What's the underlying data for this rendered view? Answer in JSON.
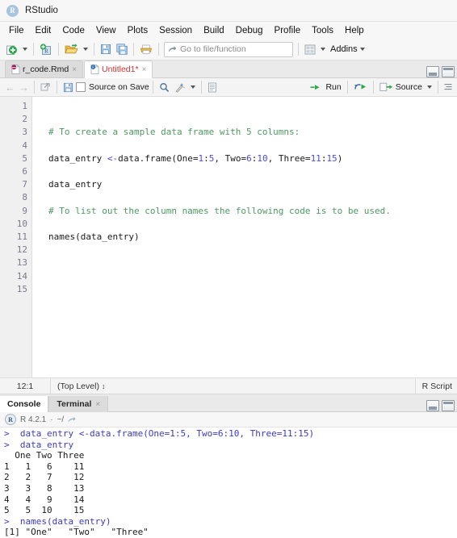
{
  "window": {
    "app_title": "RStudio",
    "logo_letter": "R"
  },
  "menubar": {
    "items": [
      {
        "label": "File"
      },
      {
        "label": "Edit"
      },
      {
        "label": "Code"
      },
      {
        "label": "View"
      },
      {
        "label": "Plots"
      },
      {
        "label": "Session"
      },
      {
        "label": "Build"
      },
      {
        "label": "Debug"
      },
      {
        "label": "Profile"
      },
      {
        "label": "Tools"
      },
      {
        "label": "Help"
      }
    ]
  },
  "toolbar": {
    "new_file_icon": "new-file-icon",
    "new_project_icon": "new-project-icon",
    "open_file_icon": "open-folder-icon",
    "save_icon": "save-icon",
    "save_all_icon": "save-all-icon",
    "print_icon": "print-icon",
    "goto_placeholder": "Go to file/function",
    "goto_value": "",
    "workspace_panes_icon": "workspace-panes-icon",
    "addins_label": "Addins"
  },
  "source_pane": {
    "tabs": [
      {
        "label": "r_code.Rmd",
        "icon": "rmarkdown-file-icon",
        "active": false,
        "modified": false
      },
      {
        "label": "Untitled1*",
        "icon": "r-script-file-icon",
        "active": true,
        "modified": true
      }
    ],
    "close_glyph": "×",
    "editor_toolbar": {
      "back_label": "←",
      "forward_label": "→",
      "popout_icon": "show-in-new-window-icon",
      "save_icon": "save-icon",
      "source_on_save_label": "Source on Save",
      "source_on_save_checked": false,
      "find_icon": "magnifier-icon",
      "magic_icon": "code-tools-icon",
      "compile_report_icon": "compile-report-icon",
      "run_label": "Run",
      "rerun_icon": "rerun-icon",
      "source_label": "Source",
      "outline_icon": "document-outline-icon"
    },
    "line_numbers": [
      "1",
      "2",
      "3",
      "4",
      "5",
      "6",
      "7",
      "8",
      "9",
      "10",
      "11",
      "12",
      "13",
      "14",
      "15"
    ],
    "code_lines": [
      {
        "n": 1,
        "segments": []
      },
      {
        "n": 2,
        "segments": []
      },
      {
        "n": 3,
        "segments": [
          {
            "t": "# To create a sample data frame with 5 columns:",
            "c": "cm"
          }
        ]
      },
      {
        "n": 4,
        "segments": []
      },
      {
        "n": 5,
        "segments": [
          {
            "t": "data_entry ",
            "c": "tx"
          },
          {
            "t": "<-",
            "c": "op"
          },
          {
            "t": "data.frame(One=",
            "c": "tx"
          },
          {
            "t": "1",
            "c": "num"
          },
          {
            "t": ":",
            "c": "tx"
          },
          {
            "t": "5",
            "c": "num"
          },
          {
            "t": ", Two=",
            "c": "tx"
          },
          {
            "t": "6",
            "c": "num"
          },
          {
            "t": ":",
            "c": "tx"
          },
          {
            "t": "10",
            "c": "num"
          },
          {
            "t": ", Three=",
            "c": "tx"
          },
          {
            "t": "11",
            "c": "num"
          },
          {
            "t": ":",
            "c": "tx"
          },
          {
            "t": "15",
            "c": "num"
          },
          {
            "t": ")",
            "c": "tx"
          }
        ]
      },
      {
        "n": 6,
        "segments": []
      },
      {
        "n": 7,
        "segments": [
          {
            "t": "data_entry",
            "c": "tx"
          }
        ]
      },
      {
        "n": 8,
        "segments": []
      },
      {
        "n": 9,
        "segments": [
          {
            "t": "# To list out the column names the following code is to be used.",
            "c": "cm"
          }
        ]
      },
      {
        "n": 10,
        "segments": []
      },
      {
        "n": 11,
        "segments": [
          {
            "t": "names(data_entry)",
            "c": "tx"
          }
        ]
      },
      {
        "n": 12,
        "segments": []
      },
      {
        "n": 13,
        "segments": []
      },
      {
        "n": 14,
        "segments": []
      },
      {
        "n": 15,
        "segments": []
      }
    ],
    "statusbar": {
      "cursor_position": "12:1",
      "scope": "(Top Level)",
      "scope_caret": "↕",
      "file_type": "R Script"
    }
  },
  "console_pane": {
    "tabs": [
      {
        "label": "Console",
        "active": true,
        "closable": false
      },
      {
        "label": "Terminal",
        "active": false,
        "closable": true
      }
    ],
    "close_glyph": "×",
    "header": {
      "r_badge": "R",
      "version": "R 4.2.1",
      "separator": "·",
      "working_dir": "~/",
      "popout_icon": "view-in-new-window-icon"
    },
    "output_lines": [
      {
        "prompt": ">",
        "text": "  data_entry <-data.frame(One=1:5, Two=6:10, Three=11:15)",
        "kind": "input"
      },
      {
        "prompt": ">",
        "text": "  data_entry",
        "kind": "input"
      },
      {
        "prompt": "",
        "text": "  One Two Three",
        "kind": "output"
      },
      {
        "prompt": "",
        "text": "1   1   6    11",
        "kind": "output"
      },
      {
        "prompt": "",
        "text": "2   2   7    12",
        "kind": "output"
      },
      {
        "prompt": "",
        "text": "3   3   8    13",
        "kind": "output"
      },
      {
        "prompt": "",
        "text": "4   4   9    14",
        "kind": "output"
      },
      {
        "prompt": "",
        "text": "5   5  10    15",
        "kind": "output"
      },
      {
        "prompt": ">",
        "text": "  names(data_entry)",
        "kind": "input"
      },
      {
        "prompt": "",
        "text": "[1] \"One\"   \"Two\"   \"Three\"",
        "kind": "output"
      }
    ]
  },
  "colors": {
    "comment_green": "#4c9a61",
    "number_blue": "#4a4ad6",
    "console_input_blue": "#3a3acb",
    "modified_tab_red": "#cf2f2f",
    "toolbar_bg": "#f7f7f7"
  }
}
